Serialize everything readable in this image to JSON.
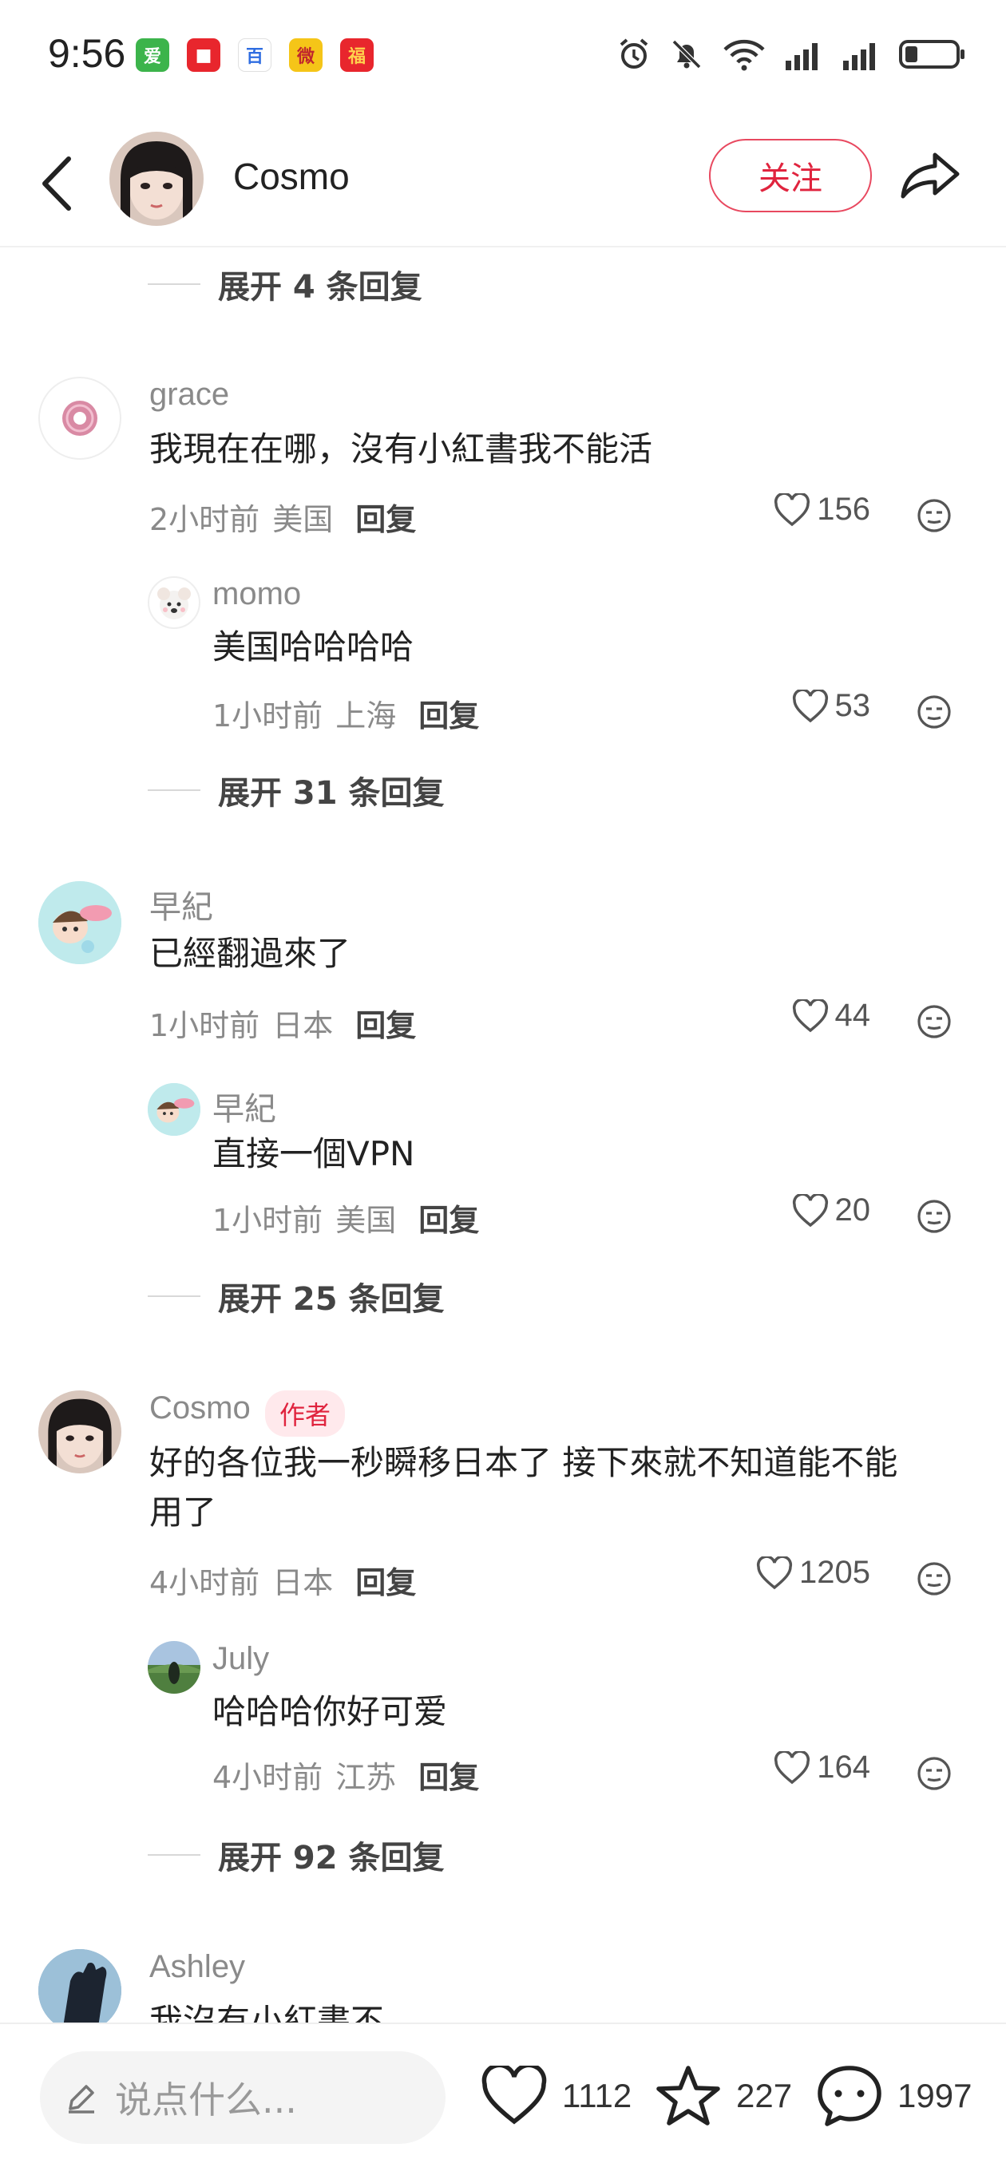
{
  "status_bar": {
    "time": "9:56",
    "apps": [
      "爱",
      "■",
      "百",
      "微",
      "福"
    ],
    "battery_level": 0.25
  },
  "header": {
    "username": "Cosmo",
    "follow_label": "关注"
  },
  "comments": {
    "expand_1": "展开 4 条回复",
    "c1": {
      "user": "grace",
      "text": "我現在在哪，沒有小紅書我不能活",
      "time": "2小时前",
      "location": "美国",
      "reply_label": "回复",
      "likes": "156",
      "sub": {
        "user": "momo",
        "text": "美国哈哈哈哈",
        "time": "1小时前",
        "location": "上海",
        "reply_label": "回复",
        "likes": "53"
      },
      "expand": "展开 31 条回复"
    },
    "c2": {
      "user": "早紀",
      "text": "已經翻過來了",
      "time": "1小时前",
      "location": "日本",
      "reply_label": "回复",
      "likes": "44",
      "sub": {
        "user": "早紀",
        "text": "直接一個VPN",
        "time": "1小时前",
        "location": "美国",
        "reply_label": "回复",
        "likes": "20"
      },
      "expand": "展开 25 条回复"
    },
    "c3": {
      "user": "Cosmo",
      "badge": "作者",
      "text_line1": "好的各位我一秒瞬移日本了 接下來就不知道能不能",
      "text_line2": "用了",
      "time": "4小时前",
      "location": "日本",
      "reply_label": "回复",
      "likes": "1205",
      "sub": {
        "user": "July",
        "text": "哈哈哈你好可爱",
        "time": "4小时前",
        "location": "江苏",
        "reply_label": "回复",
        "likes": "164"
      },
      "expand": "展开 92 条回复"
    },
    "c4": {
      "user": "Ashley",
      "text": "我沒有小紅書不..."
    }
  },
  "bottom_bar": {
    "placeholder": "说点什么...",
    "likes": "1112",
    "favorites": "227",
    "comments": "1997"
  },
  "colors": {
    "accent": "#e0243e",
    "muted_text": "#8a8a8a"
  }
}
